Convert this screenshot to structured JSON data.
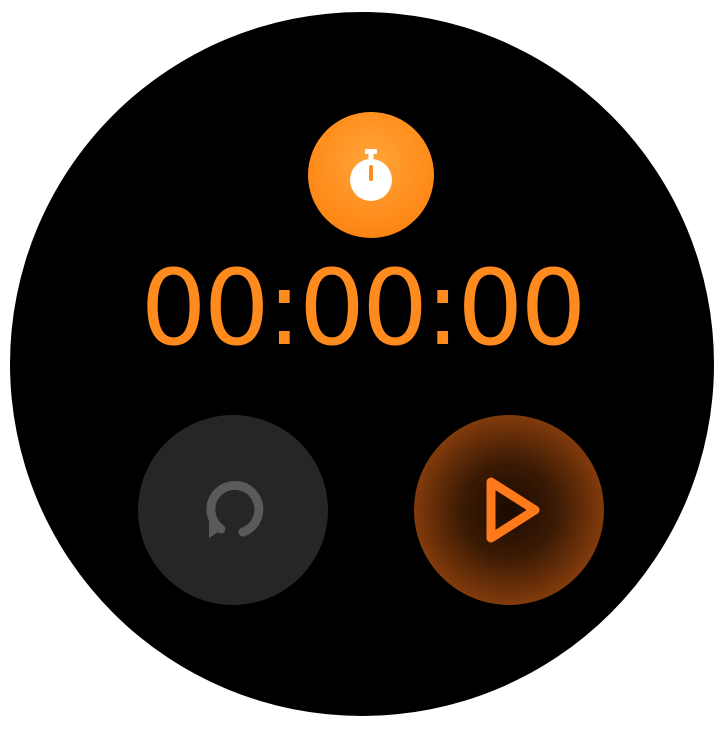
{
  "app": {
    "icon": "stopwatch-icon",
    "accent_color": "#ff8a1e"
  },
  "timer": {
    "display": "00:00:00"
  },
  "controls": {
    "reset": {
      "icon": "reset-icon",
      "enabled": false,
      "color": "#5a5a5a"
    },
    "start": {
      "icon": "play-icon",
      "color": "#ff7a1a"
    }
  }
}
